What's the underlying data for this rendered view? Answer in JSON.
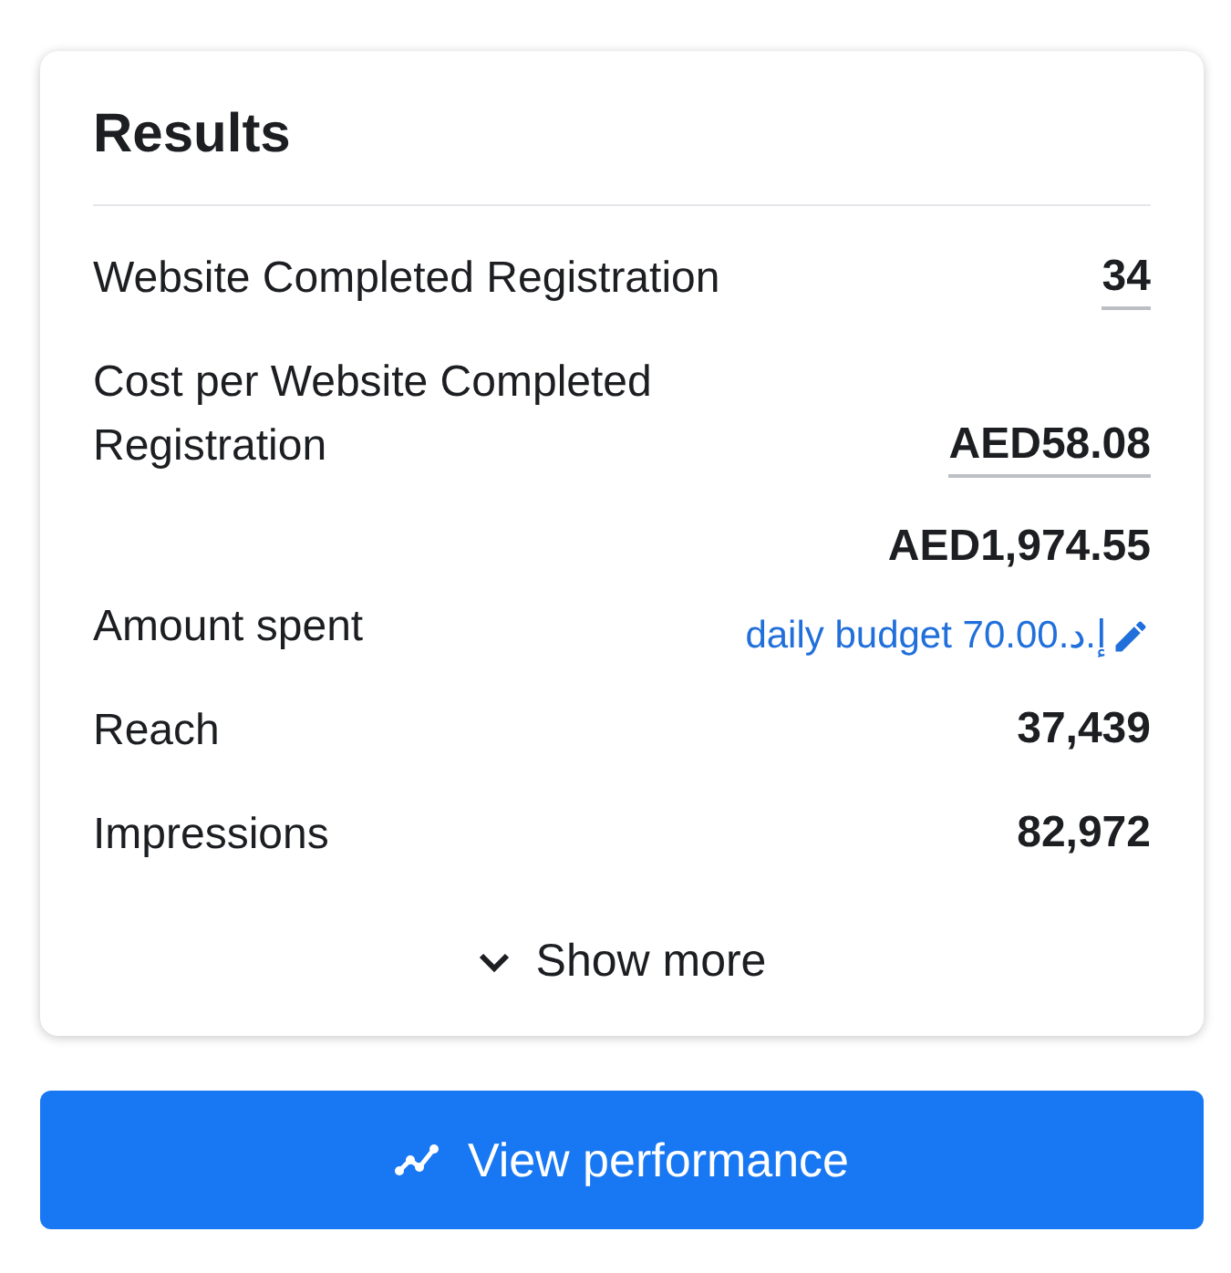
{
  "card": {
    "title": "Results",
    "rows": [
      {
        "label": "Website Completed Registration",
        "value": "34",
        "underlined": true
      },
      {
        "label": "Cost per Website Completed Registration",
        "value": "AED58.08",
        "underlined": true
      },
      {
        "label": "Amount spent",
        "value": "AED1,974.55",
        "underlined": false,
        "link": "daily budget 70.00.د.إ"
      },
      {
        "label": "Reach",
        "value": "37,439",
        "underlined": false
      },
      {
        "label": "Impressions",
        "value": "82,972",
        "underlined": false
      }
    ],
    "show_more": "Show more"
  },
  "button": {
    "label": "View performance"
  }
}
